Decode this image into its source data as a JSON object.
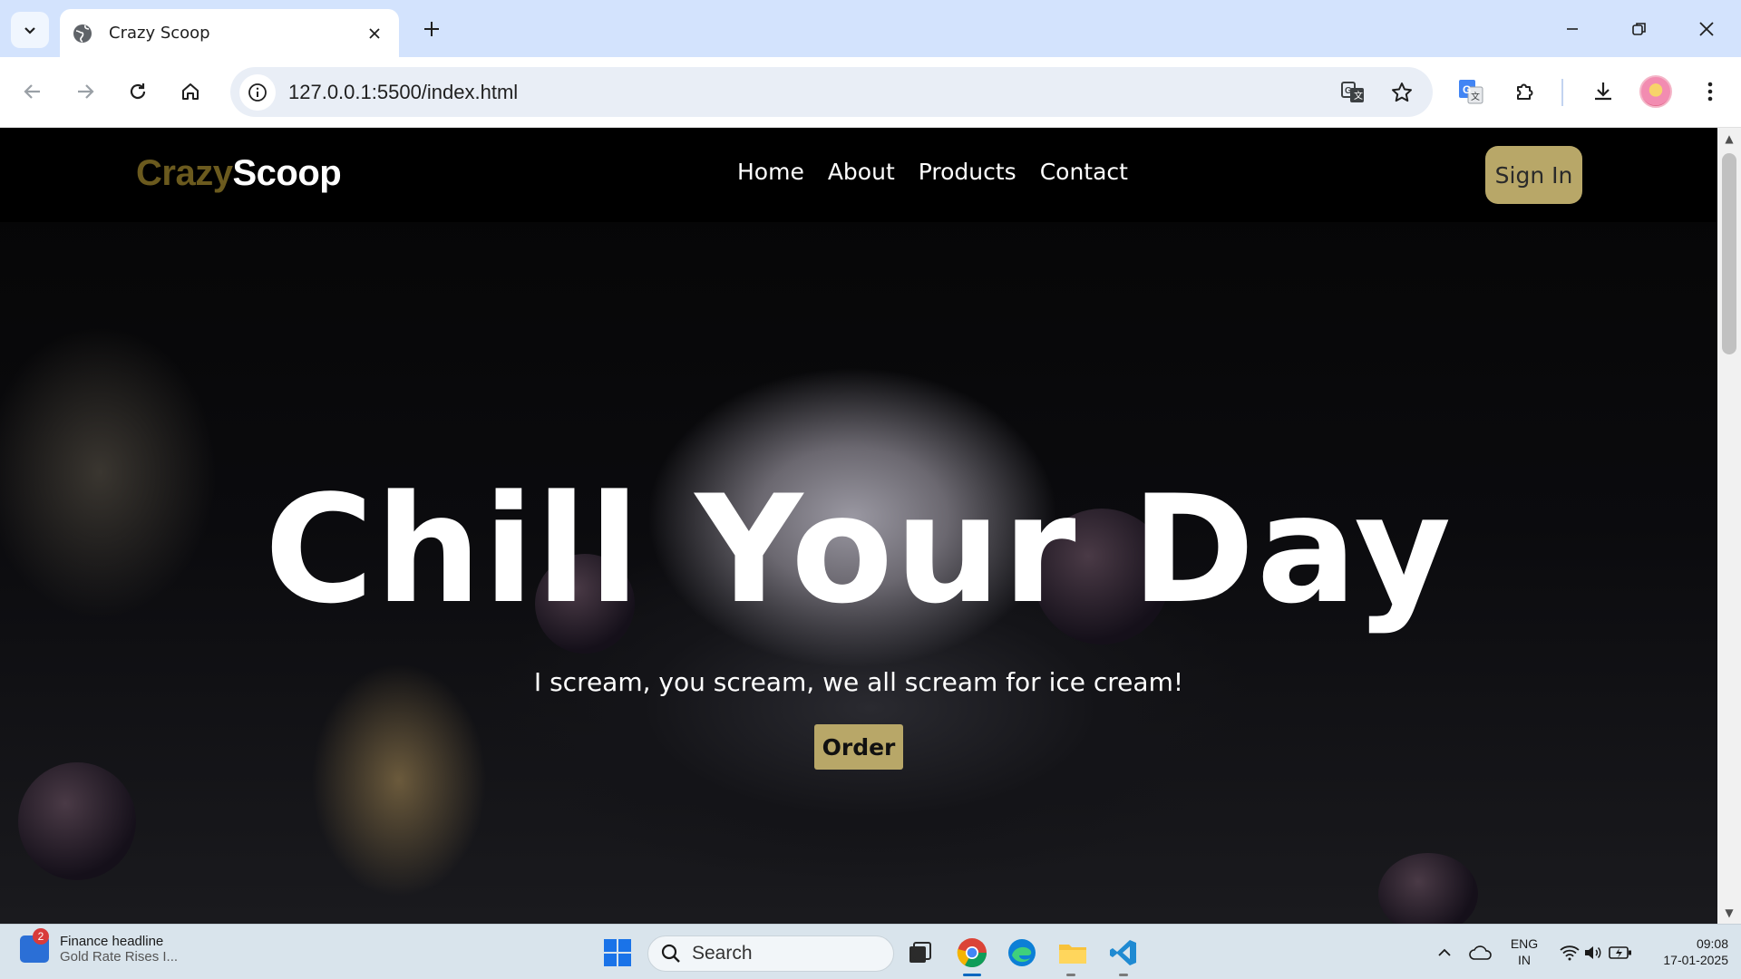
{
  "browser": {
    "tab_title": "Crazy Scoop",
    "url": "127.0.0.1:5500/index.html"
  },
  "site": {
    "logo_part1": "Crazy",
    "logo_part2": "Scoop",
    "logo_color1": "#6b5a1e",
    "accent_color": "#b8a768",
    "nav": [
      {
        "label": "Home"
      },
      {
        "label": "About"
      },
      {
        "label": "Products"
      },
      {
        "label": "Contact"
      }
    ],
    "signin_label": "Sign In",
    "hero_title": "Chill Your Day",
    "hero_subtitle": "I scream, you scream, we all scream for ice cream!",
    "order_label": "Order"
  },
  "taskbar": {
    "news_badge": "2",
    "news_title": "Finance headline",
    "news_subtitle": "Gold Rate Rises I...",
    "search_label": "Search",
    "lang_line1": "ENG",
    "lang_line2": "IN",
    "time": "09:08",
    "date": "17-01-2025"
  }
}
